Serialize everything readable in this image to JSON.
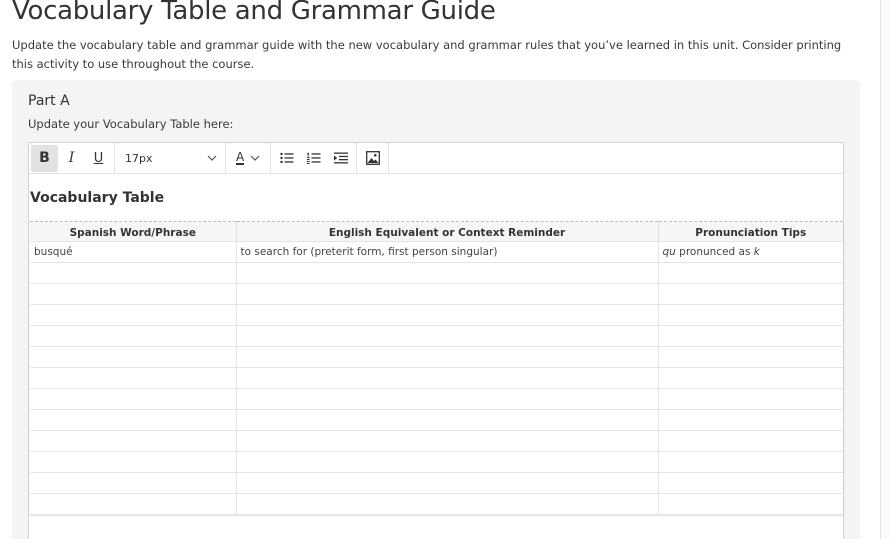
{
  "page": {
    "title": "Vocabulary Table and Grammar Guide",
    "intro": "Update the vocabulary table and grammar guide with the new vocabulary and grammar rules that you’ve learned in this unit. Consider printing this activity to use throughout the course."
  },
  "part_a": {
    "title": "Part A",
    "instruction": "Update your Vocabulary Table here:"
  },
  "toolbar": {
    "bold_label": "B",
    "italic_label": "I",
    "underline_label": "U",
    "font_size": "17px",
    "text_color_label": "A"
  },
  "editor": {
    "heading": "Vocabulary Table",
    "table": {
      "headers": [
        "Spanish Word/Phrase",
        "English Equivalent or Context Reminder",
        "Pronunciation Tips"
      ],
      "rows": [
        {
          "spanish": "busqué",
          "english": "to search for (preterit form, first person singular)",
          "tip_italic_1": "qu",
          "tip_text": " pronunced as ",
          "tip_italic_2": "k"
        }
      ],
      "empty_rows": 12
    }
  }
}
